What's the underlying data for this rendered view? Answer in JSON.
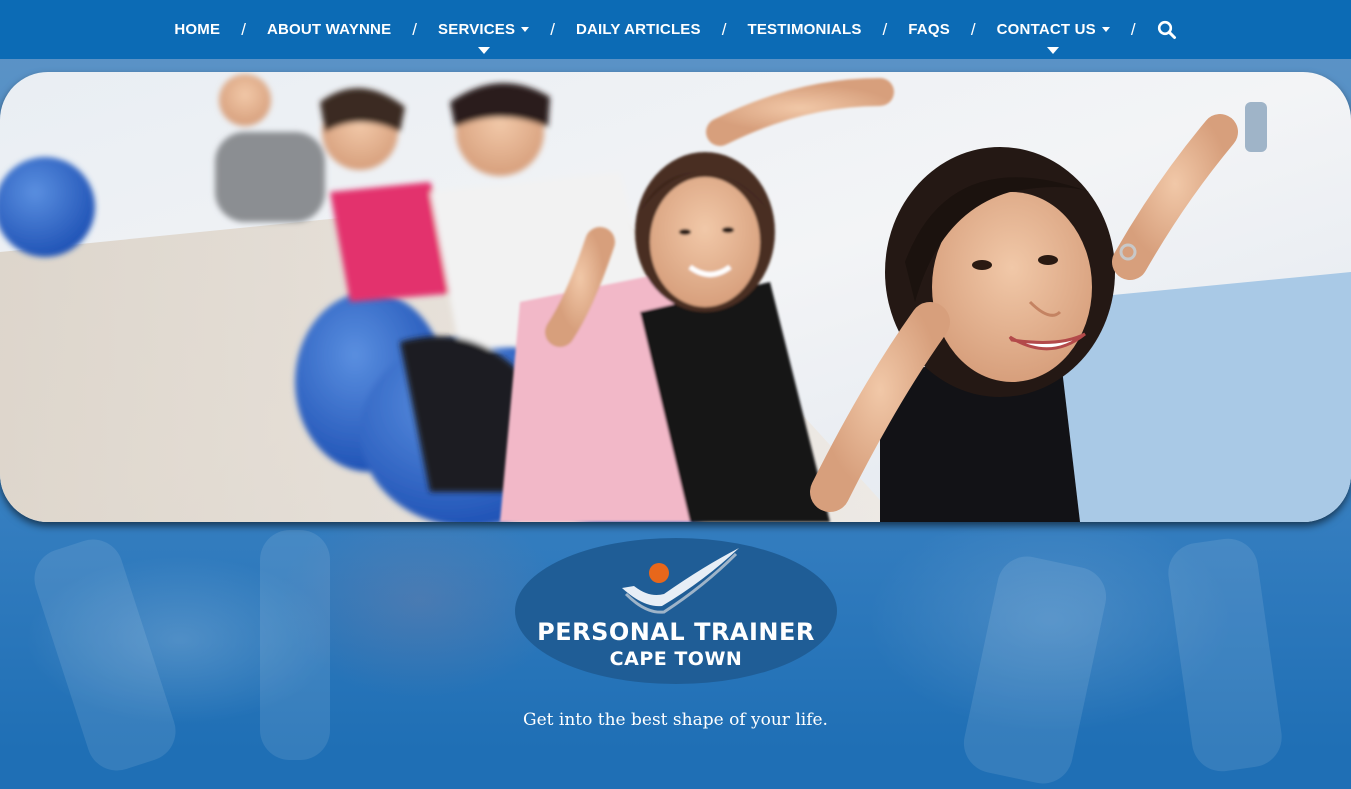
{
  "nav": {
    "items": [
      {
        "label": "HOME",
        "dropdown": false
      },
      {
        "label": "ABOUT WAYNNE",
        "dropdown": false
      },
      {
        "label": "SERVICES",
        "dropdown": true
      },
      {
        "label": "DAILY ARTICLES",
        "dropdown": false
      },
      {
        "label": "TESTIMONIALS",
        "dropdown": false
      },
      {
        "label": "FAQS",
        "dropdown": false
      },
      {
        "label": "CONTACT US",
        "dropdown": true
      }
    ],
    "separator": "/",
    "search_icon": "search-icon"
  },
  "hero": {
    "image": "group-fitness-class-photo"
  },
  "logo": {
    "line1": "PERSONAL TRAINER",
    "line2": "CAPE TOWN",
    "icon": "check-swoosh-ball-icon"
  },
  "tagline": "Get into the best shape of your life.",
  "colors": {
    "nav_bg": "#0c6bb5",
    "page_blue": "#1f6fb5",
    "logo_oval": "#1f5c93",
    "ball_orange": "#e8671b"
  }
}
